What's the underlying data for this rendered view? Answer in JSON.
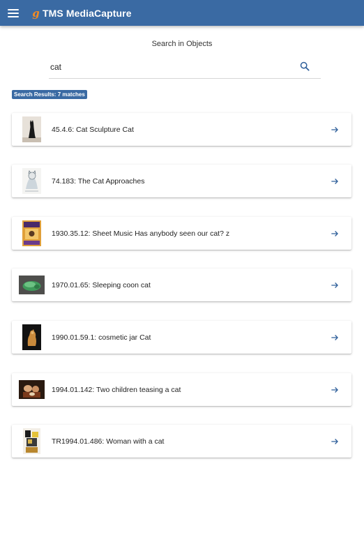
{
  "app": {
    "title": "TMS MediaCapture",
    "logo_letter": "g"
  },
  "search": {
    "heading": "Search in Objects",
    "value": "cat"
  },
  "results": {
    "badge": "Search Results: 7 matches",
    "items": [
      {
        "label": "45.4.6: Cat Sculpture Cat",
        "thumb": "cat-sculpture-thumbnail"
      },
      {
        "label": "74.183: The Cat Approaches",
        "thumb": "cat-approaches-thumbnail"
      },
      {
        "label": "1930.35.12: Sheet Music Has anybody seen our cat? z",
        "thumb": "sheet-music-thumbnail"
      },
      {
        "label": "1970.01.65: Sleeping coon cat",
        "thumb": "sleeping-cat-thumbnail"
      },
      {
        "label": "1990.01.59.1: cosmetic jar Cat",
        "thumb": "cosmetic-jar-thumbnail"
      },
      {
        "label": "1994.01.142: Two children teasing a cat",
        "thumb": "children-painting-thumbnail"
      },
      {
        "label": "TR1994.01.486: Woman with a cat",
        "thumb": "woman-cat-thumbnail"
      }
    ]
  },
  "colors": {
    "primary": "#3a6aa3",
    "accent": "#2f5f9a",
    "logo": "#f08a24"
  }
}
